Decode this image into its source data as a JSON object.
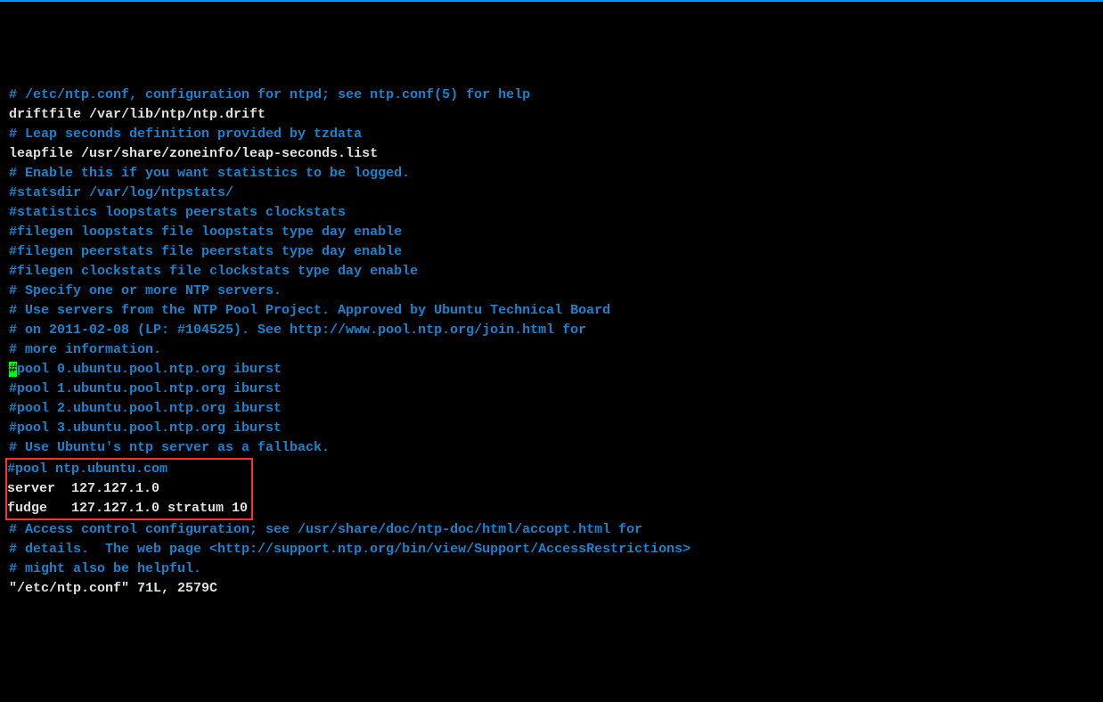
{
  "lines": {
    "l1": "# /etc/ntp.conf, configuration for ntpd; see ntp.conf(5) for help",
    "l2": "",
    "l3": "driftfile /var/lib/ntp/ntp.drift",
    "l4": "",
    "l5": "# Leap seconds definition provided by tzdata",
    "l6": "leapfile /usr/share/zoneinfo/leap-seconds.list",
    "l7": "",
    "l8": "# Enable this if you want statistics to be logged.",
    "l9": "#statsdir /var/log/ntpstats/",
    "l10": "",
    "l11": "#statistics loopstats peerstats clockstats",
    "l12": "#filegen loopstats file loopstats type day enable",
    "l13": "#filegen peerstats file peerstats type day enable",
    "l14": "#filegen clockstats file clockstats type day enable",
    "l15": "",
    "l16": "# Specify one or more NTP servers.",
    "l17": "",
    "l18": "# Use servers from the NTP Pool Project. Approved by Ubuntu Technical Board",
    "l19": "# on 2011-02-08 (LP: #104525). See http://www.pool.ntp.org/join.html for",
    "l20": "# more information.",
    "l21a": "#",
    "l21b": "pool 0.ubuntu.pool.ntp.org iburst",
    "l22": "#pool 1.ubuntu.pool.ntp.org iburst",
    "l23": "#pool 2.ubuntu.pool.ntp.org iburst",
    "l24": "#pool 3.ubuntu.pool.ntp.org iburst",
    "l25": "",
    "l26": "# Use Ubuntu's ntp server as a fallback.",
    "l27": "#pool ntp.ubuntu.com",
    "l28": "server  127.127.1.0",
    "l29": "fudge   127.127.1.0 stratum 10",
    "l30": "",
    "l31": "# Access control configuration; see /usr/share/doc/ntp-doc/html/accopt.html for",
    "l32": "# details.  The web page <http://support.ntp.org/bin/view/Support/AccessRestrictions>",
    "l33": "# might also be helpful.",
    "l34": "\"/etc/ntp.conf\" 71L, 2579C"
  }
}
